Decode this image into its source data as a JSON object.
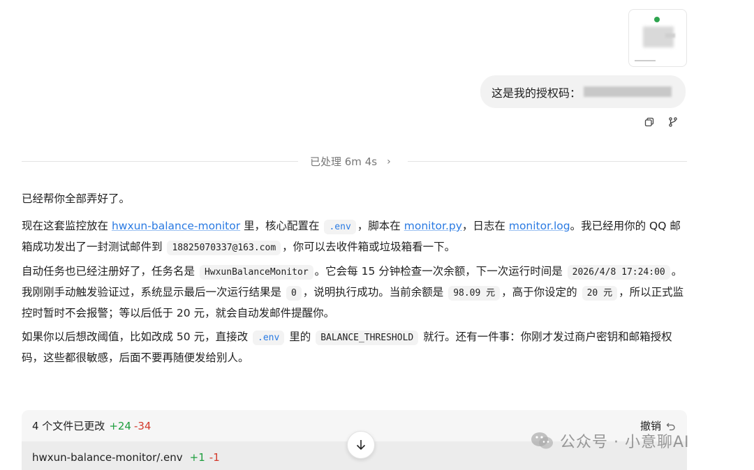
{
  "user_message": {
    "text": "这是我的授权码："
  },
  "actions": {
    "copy_icon": "copy-icon",
    "branch_icon": "branch-icon"
  },
  "processed": {
    "label": "已处理 6m 4s"
  },
  "assistant": {
    "p1": "已经帮你全部弄好了。",
    "p2": {
      "t1": "现在这套监控放在 ",
      "link1": "hwxun-balance-monitor",
      "t2": " 里，核心配置在 ",
      "code1": ".env",
      "t3": "，脚本在 ",
      "link2": "monitor.py",
      "t4": "，日志在 ",
      "link3": "monitor.log",
      "t5": "。我已经用你的 QQ 邮箱成功发出了一封测试邮件到 ",
      "code2": "18825070337@163.com",
      "t6": "，你可以去收件箱或垃圾箱看一下。"
    },
    "p3": {
      "t1": "自动任务也已经注册好了，任务名是 ",
      "code1": "HwxunBalanceMonitor",
      "t2": "。它会每 15 分钟检查一次余额，下一次运行时间是 ",
      "code2": "2026/4/8 17:24:00",
      "t3": "。我刚刚手动触发验证过，系统显示最后一次运行结果是 ",
      "code3": "0",
      "t4": "，说明执行成功。当前余额是 ",
      "code4": "98.09 元",
      "t5": "，高于你设定的 ",
      "code5": "20 元",
      "t6": "，所以正式监控时暂时不会报警；等以后低于 20 元，就会自动发邮件提醒你。"
    },
    "p4": {
      "t1": "如果你以后想改阈值，比如改成 50 元，直接改 ",
      "code1": ".env",
      "t2": " 里的 ",
      "code2": "BALANCE_THRESHOLD",
      "t3": " 就行。还有一件事：你刚才发过商户密钥和邮箱授权码，这些都很敏感，后面不要再随便发给别人。"
    }
  },
  "changes": {
    "summary": "4 个文件已更改",
    "added": "+24",
    "removed": "-34",
    "undo_label": "撤销",
    "file": {
      "name": "hwxun-balance-monitor/.env",
      "added": "+1",
      "removed": "-1"
    }
  },
  "watermark": {
    "text": "公众号 · 小意聊AI"
  }
}
